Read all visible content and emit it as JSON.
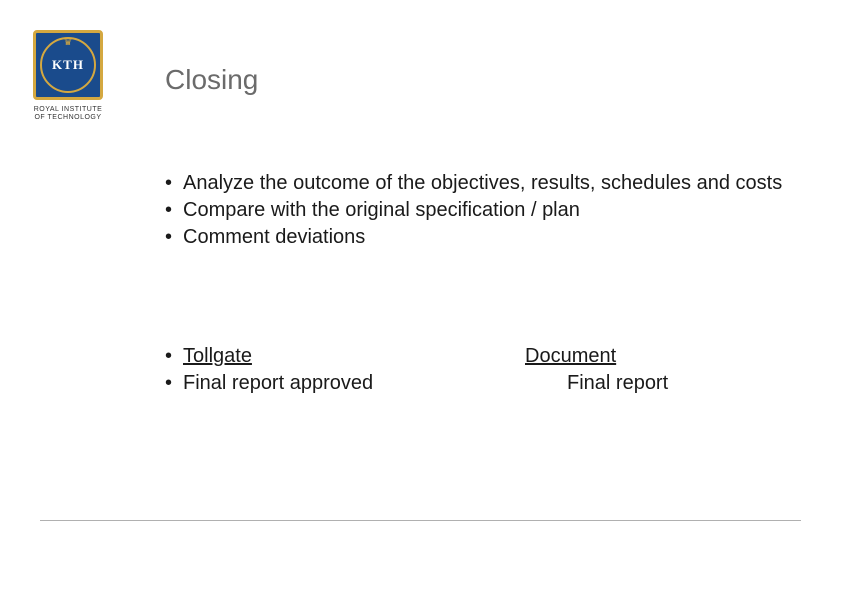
{
  "logo": {
    "text": "KTH",
    "caption_line1": "ROYAL INSTITUTE",
    "caption_line2": "OF TECHNOLOGY"
  },
  "title": "Closing",
  "bullets_top": [
    "Analyze the outcome of the objectives, results, schedules and costs",
    "Compare with the original specification / plan",
    "Comment deviations"
  ],
  "bullets_bottom": [
    {
      "text": "Tollgate",
      "underline": true
    },
    {
      "text": "Final report approved",
      "underline": false
    }
  ],
  "document": {
    "heading": "Document",
    "items": [
      "Final report"
    ]
  }
}
